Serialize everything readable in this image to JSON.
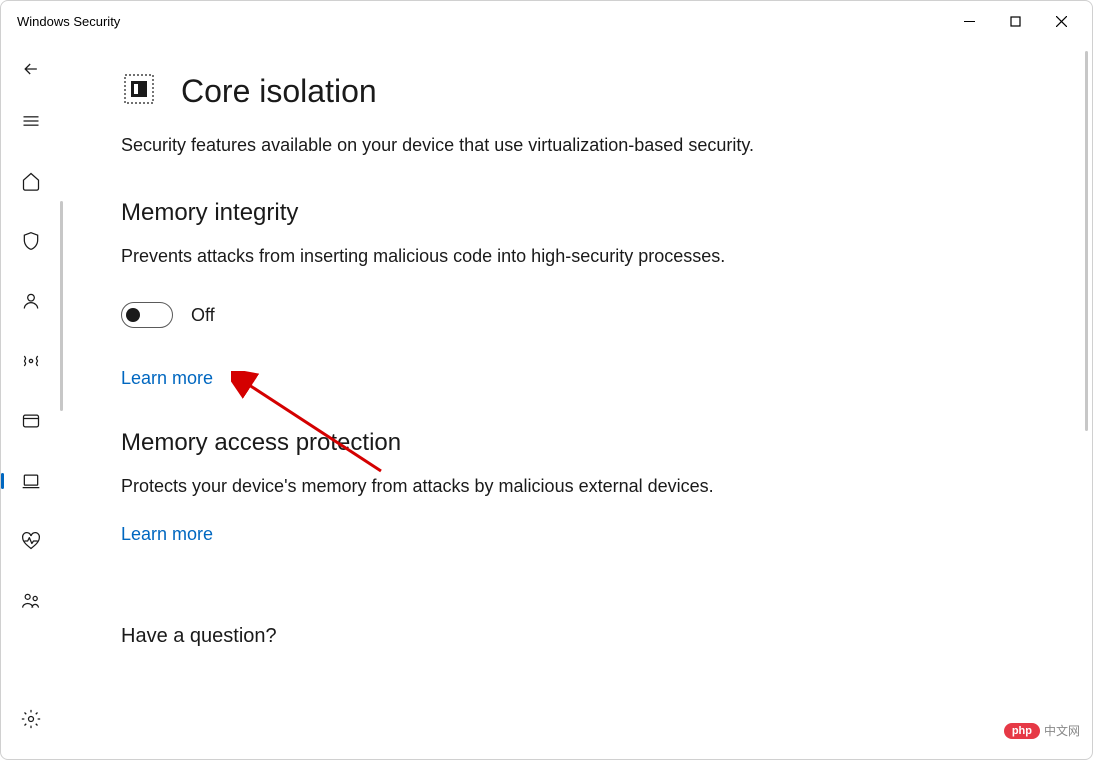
{
  "window": {
    "title": "Windows Security"
  },
  "page": {
    "title": "Core isolation",
    "description": "Security features available on your device that use virtualization-based security."
  },
  "sections": {
    "memory_integrity": {
      "title": "Memory integrity",
      "description": "Prevents attacks from inserting malicious code into high-security processes.",
      "toggle_state": "Off",
      "learn_more": "Learn more"
    },
    "memory_access": {
      "title": "Memory access protection",
      "description": "Protects your device's memory from attacks by malicious external devices.",
      "learn_more": "Learn more"
    }
  },
  "footer": {
    "question": "Have a question?"
  },
  "watermark": {
    "badge": "php",
    "text": "中文网"
  }
}
